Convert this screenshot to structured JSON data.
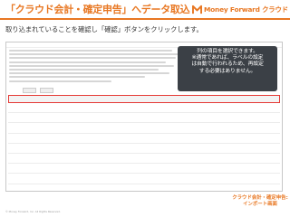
{
  "header": {
    "title": "「クラウド会計・確定申告」へデータ取込",
    "logo_text": "Money Forward クラウド",
    "brand_color": "#e87722"
  },
  "subtitle": "取り込まれていることを確認し「確認」ボタンをクリックします。",
  "callout": {
    "lines": [
      "列の項目を選択できます。",
      "※通常であれば、ラベルの設定",
      "は自動で行われるため、再設定",
      "する必要はありません。"
    ]
  },
  "highlight_color": "#e53935",
  "footer": {
    "label_lines": [
      "クラウド会計・確定申告:",
      "インポート画面"
    ],
    "copyright": "© Money Forward, Inc. All Rights Reserved."
  }
}
